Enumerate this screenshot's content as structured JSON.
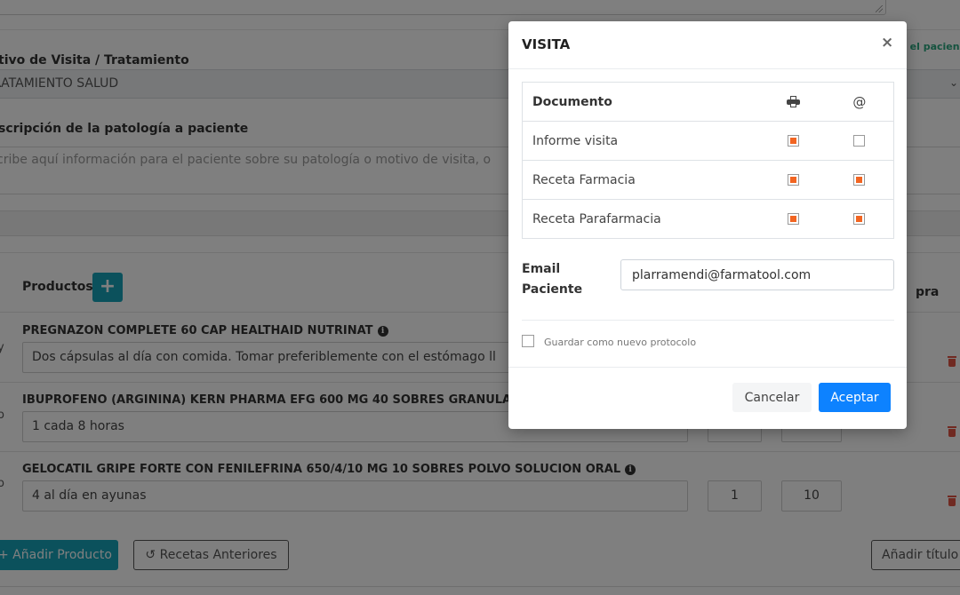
{
  "background": {
    "motivo_label": "tivo de Visita / Tratamiento",
    "motivo_value": "RATAMIENTO SALUD",
    "patient_link": "n el pacien",
    "descripcion_label": "scripción de la patología a paciente",
    "descripcion_placeholder": "cribe aquí información para el paciente sobre su patología o motivo de visita, o",
    "productos_label": "Productos",
    "plus_label": "+",
    "compra_label": "pra",
    "products": [
      {
        "name": "PREGNAZON COMPLETE 60 CAP HEALTHAID NUTRINAT",
        "posology": "Dos cápsulas al día con comida. Tomar preferiblemente con el estómago ll",
        "qty": "",
        "price": "",
        "mark": "y"
      },
      {
        "name": "IBUPROFENO (ARGININA) KERN PHARMA EFG 600 MG 40 SOBRES GRANULADO S",
        "posology": "1 cada 8 horas",
        "qty": "",
        "price": "",
        "mark": "o"
      },
      {
        "name": "GELOCATIL GRIPE FORTE CON FENILEFRINA 650/4/10 MG 10 SOBRES POLVO SOLUCION ORAL",
        "posology": "4 al día en ayunas",
        "qty": "1",
        "price": "10",
        "mark": "o"
      }
    ],
    "add_product_button": "+ Añadir Producto",
    "prev_recipes_button": "↺ Recetas Anteriores",
    "add_title_button": "Añadir título"
  },
  "modal": {
    "title": "VISITA",
    "close": "×",
    "table": {
      "header_document": "Documento",
      "header_print_icon": "printer-icon",
      "header_email": "@",
      "rows": [
        {
          "label": "Informe visita",
          "print": true,
          "email": false
        },
        {
          "label": "Receta Farmacia",
          "print": true,
          "email": true
        },
        {
          "label": "Receta Parafarmacia",
          "print": true,
          "email": true
        }
      ]
    },
    "email_label": "Email Paciente",
    "email_value": "plarramendi@farmatool.com",
    "save_protocol_label": "Guardar como nuevo protocolo",
    "save_protocol_checked": false,
    "cancel_button": "Cancelar",
    "accept_button": "Aceptar"
  },
  "colors": {
    "accent_teal": "#17a2b8",
    "primary_blue": "#0d82ff",
    "checkbox_orange": "#f26522",
    "link_green": "#2aa77f",
    "delete_red": "#e05545"
  }
}
